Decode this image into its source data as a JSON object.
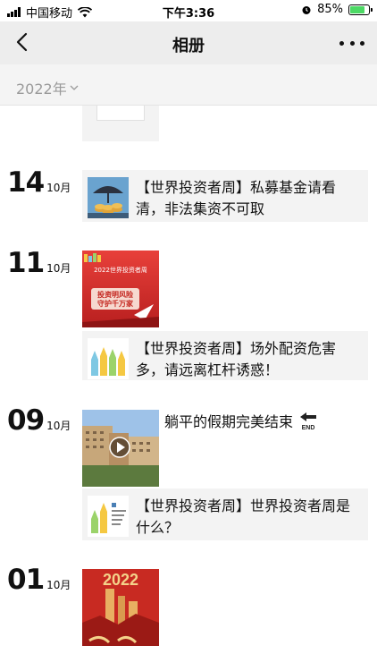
{
  "status": {
    "carrier": "中国移动",
    "time": "下午3:36",
    "battery": "85%",
    "battery_level": 0.85
  },
  "nav": {
    "title": "相册"
  },
  "year_filter": {
    "label": "2022年"
  },
  "entries": [
    {
      "day": "14",
      "month": "10月",
      "shares": [
        {
          "title": "【世界投资者周】私募基金请看清，非法集资不可取"
        }
      ]
    },
    {
      "day": "11",
      "month": "10月",
      "poster": {
        "line1": "2022世界投资者周",
        "line2": "投资明风险",
        "line3": "守护千万家"
      },
      "shares": [
        {
          "title": "【世界投资者周】场外配资危害多，请远离杠杆诱惑！"
        }
      ]
    },
    {
      "day": "09",
      "month": "10月",
      "video_caption": "躺平的假期完美结束",
      "shares": [
        {
          "title": "【世界投资者周】世界投资者周是什么？"
        }
      ]
    },
    {
      "day": "01",
      "month": "10月",
      "poster": {
        "year": "2022"
      }
    }
  ],
  "icons": {
    "back": "chevron-left-icon",
    "more": "more-dots-icon",
    "wifi": "wifi-icon",
    "end_emoji": "end-arrow-icon"
  },
  "colors": {
    "navbar_bg": "#ededed",
    "share_bg": "#f3f3f3",
    "year_text": "#9a9a9a",
    "poster_red": "#d42b2b"
  }
}
